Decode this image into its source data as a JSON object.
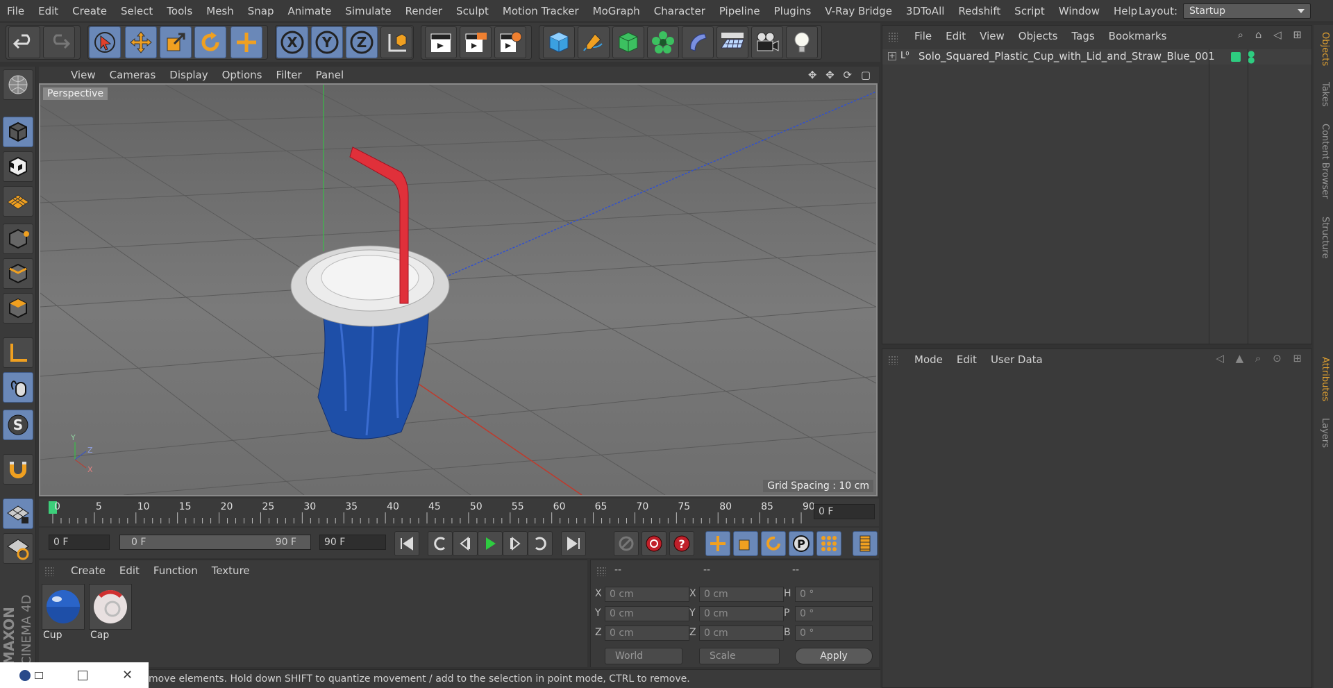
{
  "menubar": {
    "items": [
      "File",
      "Edit",
      "Create",
      "Select",
      "Tools",
      "Mesh",
      "Snap",
      "Animate",
      "Simulate",
      "Render",
      "Sculpt",
      "Motion Tracker",
      "MoGraph",
      "Character",
      "Pipeline",
      "Plugins",
      "V-Ray Bridge",
      "3DToAll",
      "Redshift",
      "Script",
      "Window",
      "Help"
    ],
    "layout_label": "Layout:",
    "layout_value": "Startup"
  },
  "viewport": {
    "menu": [
      "View",
      "Cameras",
      "Display",
      "Options",
      "Filter",
      "Panel"
    ],
    "label": "Perspective",
    "grid_spacing": "Grid Spacing : 10 cm"
  },
  "timeline": {
    "ticks": [
      "0",
      "5",
      "10",
      "15",
      "20",
      "25",
      "30",
      "35",
      "40",
      "45",
      "50",
      "55",
      "60",
      "65",
      "70",
      "75",
      "80",
      "85",
      "90"
    ],
    "current_frame": "0 F"
  },
  "transport": {
    "start_field": "0 F",
    "range_start": "0 F",
    "range_end": "90 F",
    "end_field": "90 F"
  },
  "material_panel": {
    "menu": [
      "Create",
      "Edit",
      "Function",
      "Texture"
    ],
    "materials": [
      {
        "name": "Cup",
        "color": "#1e4fa8"
      },
      {
        "name": "Cap",
        "color": "#e8e0e0"
      }
    ]
  },
  "coord_panel": {
    "headers": [
      "--",
      "--",
      "--"
    ],
    "rows": [
      {
        "l1": "X",
        "v1": "0 cm",
        "l2": "X",
        "v2": "0 cm",
        "l3": "H",
        "v3": "0 °"
      },
      {
        "l1": "Y",
        "v1": "0 cm",
        "l2": "Y",
        "v2": "0 cm",
        "l3": "P",
        "v3": "0 °"
      },
      {
        "l1": "Z",
        "v1": "0 cm",
        "l2": "Z",
        "v2": "0 cm",
        "l3": "B",
        "v3": "0 °"
      }
    ],
    "world_select": "World",
    "scale_select": "Scale",
    "apply_label": "Apply"
  },
  "object_panel": {
    "menu": [
      "File",
      "Edit",
      "View",
      "Objects",
      "Tags",
      "Bookmarks"
    ],
    "object_name": "Solo_Squared_Plastic_Cup_with_Lid_and_Straw_Blue_001"
  },
  "attribute_panel": {
    "menu": [
      "Mode",
      "Edit",
      "User Data"
    ]
  },
  "side_tabs": {
    "top": [
      "Objects",
      "Takes",
      "Content Browser",
      "Structure"
    ],
    "bottom": [
      "Attributes",
      "Layers"
    ]
  },
  "status_text": "move elements. Hold down SHIFT to quantize movement / add to the selection in point mode, CTRL to remove.",
  "brand": {
    "line1": "MAXON",
    "line2": "CINEMA 4D"
  },
  "colors": {
    "accent_blue": "#6a88b8",
    "panel": "#3a3a3a",
    "axis_x": "#c0392b",
    "axis_y": "#2ecc40",
    "axis_z": "#3050d0"
  }
}
